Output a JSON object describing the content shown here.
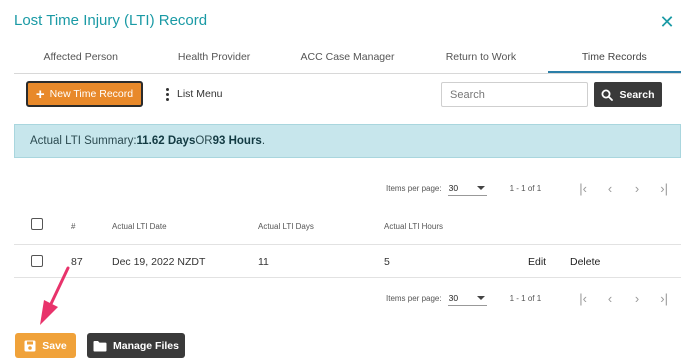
{
  "dialog": {
    "title": "Lost Time Injury (LTI) Record",
    "close_icon": "close-icon",
    "accent_color": "#1a9aa5"
  },
  "tabs": [
    {
      "label": "Affected Person",
      "active": false
    },
    {
      "label": "Health Provider",
      "active": false
    },
    {
      "label": "ACC Case Manager",
      "active": false
    },
    {
      "label": "Return to Work",
      "active": false
    },
    {
      "label": "Time Records",
      "active": true
    }
  ],
  "toolbar": {
    "new_label": "New Time Record",
    "new_icon": "plus-icon",
    "menu_label": "List Menu",
    "menu_icon": "kebab-icon",
    "search_placeholder": "Search",
    "search_value": "",
    "search_button_label": "Search",
    "search_icon": "search-icon"
  },
  "summary": {
    "prefix": "Actual LTI Summary: ",
    "days": "11.62 Days",
    "or": " OR ",
    "hours": "93 Hours",
    "suffix": "."
  },
  "pagination": {
    "items_per_page_label": "Items per page:",
    "items_per_page_value": "30",
    "range": "1 - 1 of 1",
    "icons": [
      "first-page-icon",
      "previous-page-icon",
      "next-page-icon",
      "last-page-icon"
    ]
  },
  "table": {
    "columns": [
      "#",
      "Actual LTI Date",
      "Actual LTI Days",
      "Actual LTI Hours"
    ],
    "rows": [
      {
        "id": "87",
        "date": "Dec 19, 2022 NZDT",
        "days": "11",
        "hours": "5",
        "edit": "Edit",
        "delete": "Delete"
      }
    ]
  },
  "footer": {
    "save_label": "Save",
    "save_icon": "floppy-disk-icon",
    "files_label": "Manage Files",
    "files_icon": "folder-icon"
  },
  "annotation": {
    "arrow_icon": "pointer-arrow-icon",
    "arrow_color": "#e8336b"
  }
}
